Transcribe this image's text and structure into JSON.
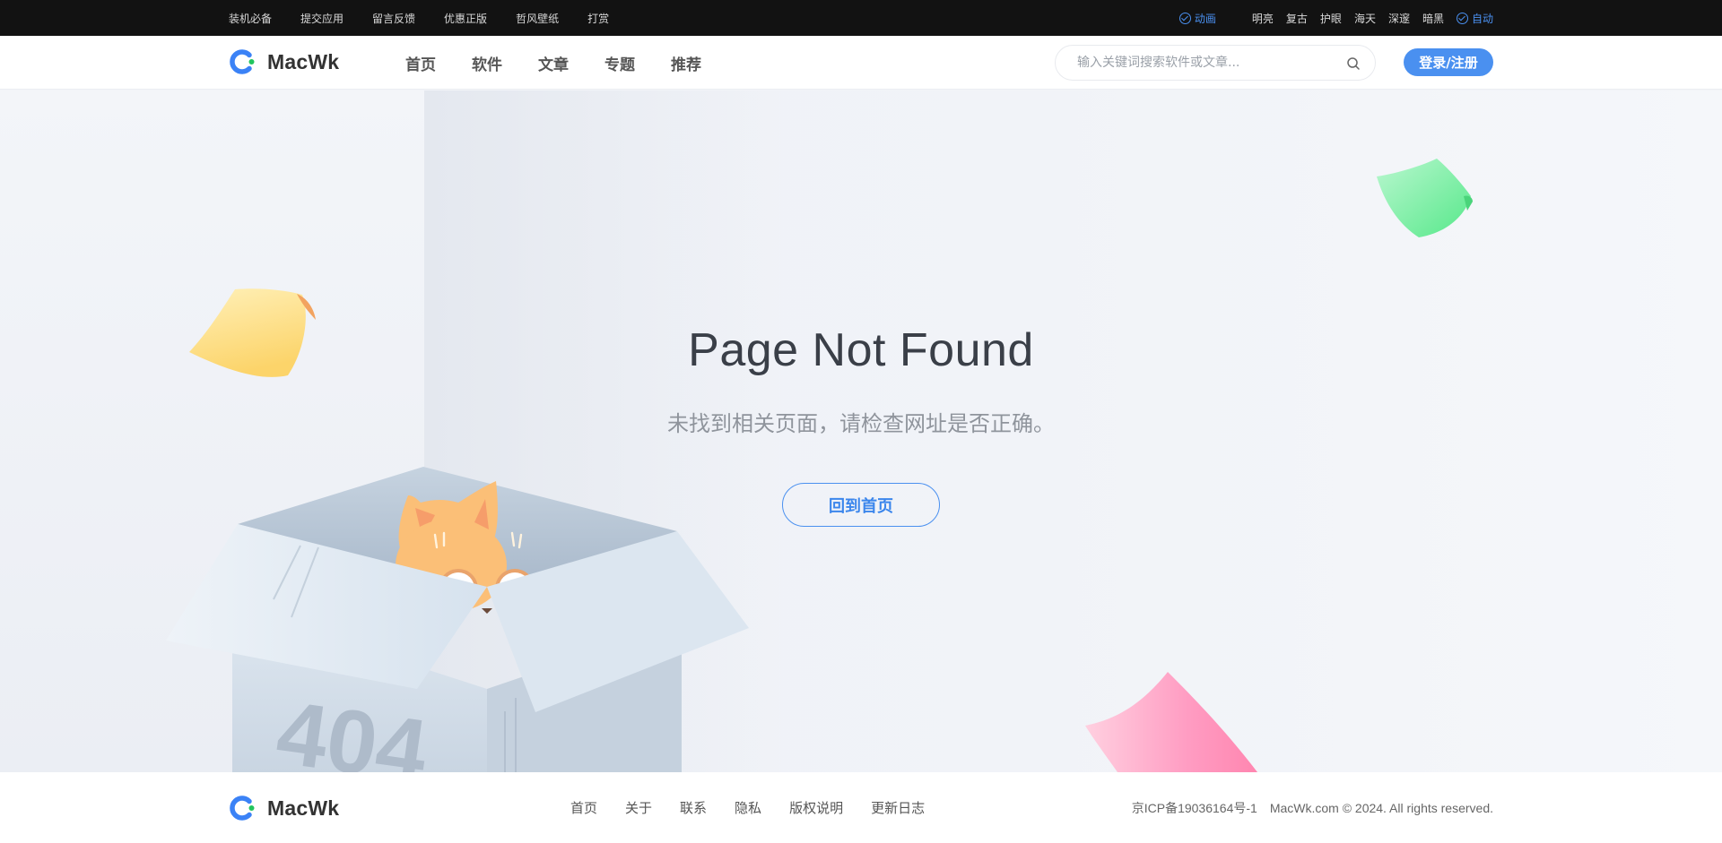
{
  "topbar": {
    "links": [
      "装机必备",
      "提交应用",
      "留言反馈",
      "优惠正版",
      "哲风壁纸",
      "打赏"
    ],
    "animation_label": "动画",
    "themes": [
      "明亮",
      "复古",
      "护眼",
      "海天",
      "深邃",
      "暗黑"
    ],
    "auto_label": "自动",
    "active_color": "#4a90f0"
  },
  "header": {
    "brand": "MacWk",
    "nav": [
      "首页",
      "软件",
      "文章",
      "专题",
      "推荐"
    ],
    "search_placeholder": "输入关键词搜索软件或文章...",
    "search_icon": "search-icon",
    "login_label": "登录/注册"
  },
  "main": {
    "title": "Page Not Found",
    "subtitle": "未找到相关页面，请检查网址是否正确。",
    "home_button": "回到首页",
    "box_text": "404"
  },
  "footer": {
    "brand": "MacWk",
    "nav": [
      "首页",
      "关于",
      "联系",
      "隐私",
      "版权说明",
      "更新日志"
    ],
    "icp": "京ICP备19036164号-1",
    "copyright": "MacWk.com © 2024. All rights reserved."
  },
  "colors": {
    "accent": "#4a90f0",
    "topbar_bg": "#121212",
    "logo_blue": "#3b82f6",
    "logo_green": "#22c55e"
  }
}
